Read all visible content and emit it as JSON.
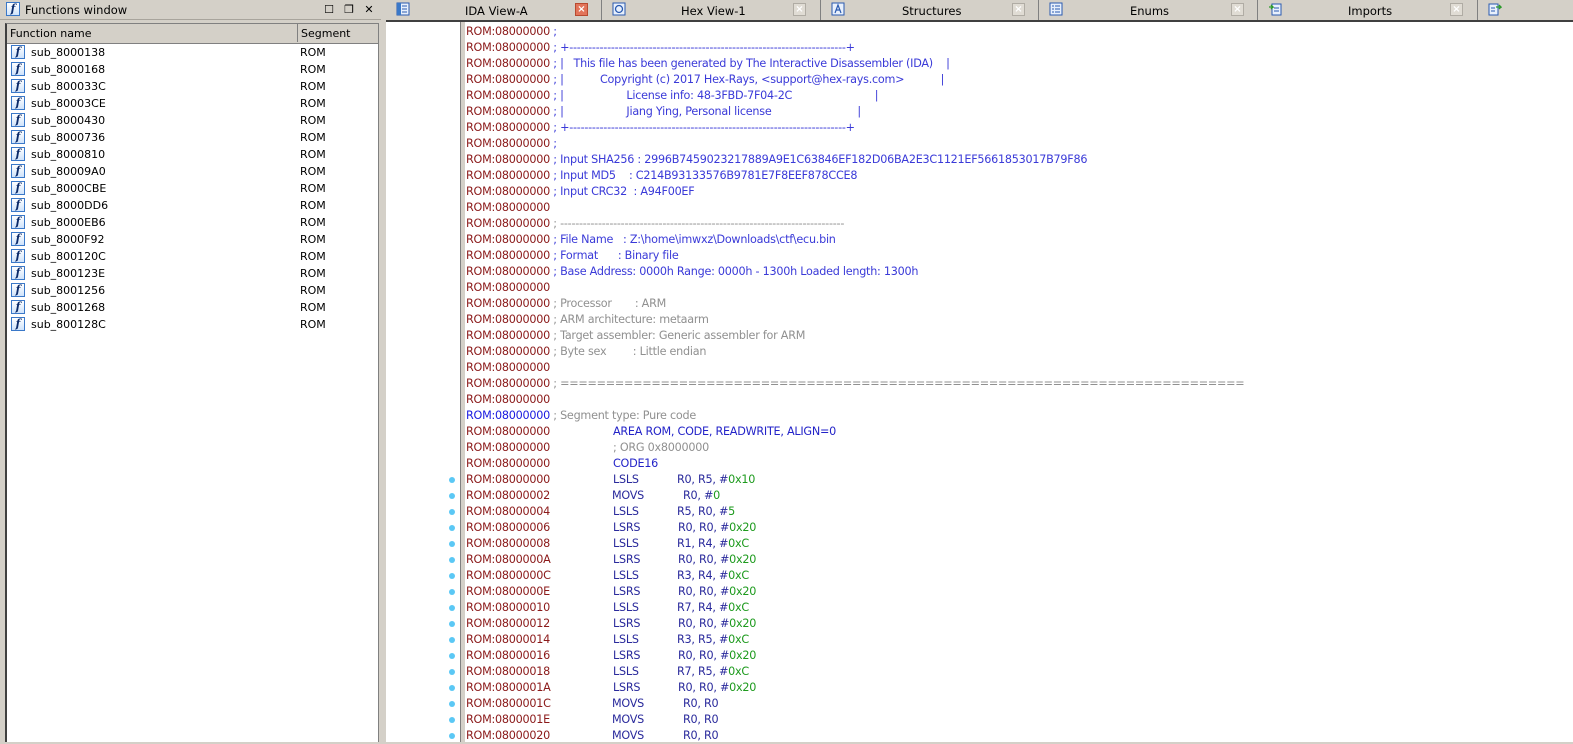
{
  "functions_window": {
    "title": "Functions window",
    "icon": "function-icon",
    "controls": [
      "maximize-icon",
      "float-icon",
      "close-icon"
    ],
    "columns": [
      "Function name",
      "Segment"
    ],
    "rows": [
      {
        "name": "sub_8000138",
        "segment": "ROM"
      },
      {
        "name": "sub_8000168",
        "segment": "ROM"
      },
      {
        "name": "sub_800033C",
        "segment": "ROM"
      },
      {
        "name": "sub_80003CE",
        "segment": "ROM"
      },
      {
        "name": "sub_8000430",
        "segment": "ROM"
      },
      {
        "name": "sub_8000736",
        "segment": "ROM"
      },
      {
        "name": "sub_8000810",
        "segment": "ROM"
      },
      {
        "name": "sub_80009A0",
        "segment": "ROM"
      },
      {
        "name": "sub_8000CBE",
        "segment": "ROM"
      },
      {
        "name": "sub_8000DD6",
        "segment": "ROM"
      },
      {
        "name": "sub_8000EB6",
        "segment": "ROM"
      },
      {
        "name": "sub_8000F92",
        "segment": "ROM"
      },
      {
        "name": "sub_800120C",
        "segment": "ROM"
      },
      {
        "name": "sub_800123E",
        "segment": "ROM"
      },
      {
        "name": "sub_8001256",
        "segment": "ROM"
      },
      {
        "name": "sub_8001268",
        "segment": "ROM"
      },
      {
        "name": "sub_800128C",
        "segment": "ROM"
      }
    ]
  },
  "tabs": [
    {
      "label": "IDA View-A",
      "icon": "ida-view-icon",
      "active": true
    },
    {
      "label": "Hex View-1",
      "icon": "hex-view-icon",
      "active": false
    },
    {
      "label": "Structures",
      "icon": "structures-icon",
      "active": false
    },
    {
      "label": "Enums",
      "icon": "enums-icon",
      "active": false
    },
    {
      "label": "Imports",
      "icon": "imports-icon",
      "active": false
    },
    {
      "label": "",
      "icon": "exports-icon",
      "active": false
    }
  ],
  "colors": {
    "address": "#8b1a1a",
    "segment_address": "#1a1ae0",
    "comment_blue": "#3a3ad8",
    "comment_gray": "#909090",
    "mnemonic": "#2a2a9c",
    "immediate": "#1d9a1d",
    "breakpoint_dot": "#5bc8f5",
    "close_active": "#e2745a"
  },
  "listing": {
    "header": [
      {
        "addr": "ROM:08000000",
        "text": " ;",
        "style": "blue"
      },
      {
        "addr": "ROM:08000000",
        "text": " ; +-------------------------------------------------------------------------+",
        "style": "blue"
      },
      {
        "addr": "ROM:08000000",
        "text": " ; |   This file has been generated by The Interactive Disassembler (IDA)    |",
        "style": "blue"
      },
      {
        "addr": "ROM:08000000",
        "text": " ; |           Copyright (c) 2017 Hex-Rays, <support@hex-rays.com>           |",
        "style": "blue"
      },
      {
        "addr": "ROM:08000000",
        "text": " ; |                   License info: 48-3FBD-7F04-2C                         |",
        "style": "blue"
      },
      {
        "addr": "ROM:08000000",
        "text": " ; |                   Jiang Ying, Personal license                          |",
        "style": "blue"
      },
      {
        "addr": "ROM:08000000",
        "text": " ; +-------------------------------------------------------------------------+",
        "style": "blue"
      },
      {
        "addr": "ROM:08000000",
        "text": " ;",
        "style": "blue"
      },
      {
        "addr": "ROM:08000000",
        "text": " ; Input SHA256 : 2996B7459023217889A9E1C63846EF182D06BA2E3C1121EF5661853017B79F86",
        "style": "blue"
      },
      {
        "addr": "ROM:08000000",
        "text": " ; Input MD5    : C214B93133576B9781E7F8EEF878CCE8",
        "style": "blue"
      },
      {
        "addr": "ROM:08000000",
        "text": " ; Input CRC32  : A94F00EF",
        "style": "blue"
      },
      {
        "addr": "ROM:08000000",
        "text": "",
        "style": "blue"
      },
      {
        "addr": "ROM:08000000",
        "text": " ; ---------------------------------------------------------------------------",
        "style": "gray"
      },
      {
        "addr": "ROM:08000000",
        "text": " ; File Name   : Z:\\home\\imwxz\\Downloads\\ctf\\ecu.bin",
        "style": "blue"
      },
      {
        "addr": "ROM:08000000",
        "text": " ; Format      : Binary file",
        "style": "blue"
      },
      {
        "addr": "ROM:08000000",
        "text": " ; Base Address: 0000h Range: 0000h - 1300h Loaded length: 1300h",
        "style": "blue"
      },
      {
        "addr": "ROM:08000000",
        "text": "",
        "style": "blue"
      },
      {
        "addr": "ROM:08000000",
        "text": " ; Processor       : ARM",
        "style": "gray"
      },
      {
        "addr": "ROM:08000000",
        "text": " ; ARM architecture: metaarm",
        "style": "gray"
      },
      {
        "addr": "ROM:08000000",
        "text": " ; Target assembler: Generic assembler for ARM",
        "style": "gray"
      },
      {
        "addr": "ROM:08000000",
        "text": " ; Byte sex        : Little endian",
        "style": "gray"
      },
      {
        "addr": "ROM:08000000",
        "text": "",
        "style": "gray"
      },
      {
        "addr": "ROM:08000000",
        "text": " ; ===========================================================================",
        "style": "gray"
      },
      {
        "addr": "ROM:08000000",
        "text": "",
        "style": "gray"
      },
      {
        "addr": "ROM:08000000",
        "text": " ; Segment type: Pure code",
        "style": "gray",
        "segment_addr": true
      }
    ],
    "directives": [
      {
        "addr": "ROM:08000000",
        "text": "AREA ROM, CODE, READWRITE, ALIGN=0",
        "style": "dir"
      },
      {
        "addr": "ROM:08000000",
        "text": "; ORG 0x8000000",
        "style": "gray"
      },
      {
        "addr": "ROM:08000000",
        "text": "CODE16",
        "style": "dir"
      }
    ],
    "instructions": [
      {
        "addr": "ROM:08000000",
        "mnemonic": "LSLS",
        "regs": "R0, R5, #",
        "imm": "0x10"
      },
      {
        "addr": "ROM:08000002",
        "mnemonic": "MOVS",
        "regs": "R0, #",
        "imm": "0"
      },
      {
        "addr": "ROM:08000004",
        "mnemonic": "LSLS",
        "regs": "R5, R0, #",
        "imm": "5"
      },
      {
        "addr": "ROM:08000006",
        "mnemonic": "LSRS",
        "regs": "R0, R0, #",
        "imm": "0x20"
      },
      {
        "addr": "ROM:08000008",
        "mnemonic": "LSLS",
        "regs": "R1, R4, #",
        "imm": "0xC"
      },
      {
        "addr": "ROM:0800000A",
        "mnemonic": "LSRS",
        "regs": "R0, R0, #",
        "imm": "0x20"
      },
      {
        "addr": "ROM:0800000C",
        "mnemonic": "LSLS",
        "regs": "R3, R4, #",
        "imm": "0xC"
      },
      {
        "addr": "ROM:0800000E",
        "mnemonic": "LSRS",
        "regs": "R0, R0, #",
        "imm": "0x20"
      },
      {
        "addr": "ROM:08000010",
        "mnemonic": "LSLS",
        "regs": "R7, R4, #",
        "imm": "0xC"
      },
      {
        "addr": "ROM:08000012",
        "mnemonic": "LSRS",
        "regs": "R0, R0, #",
        "imm": "0x20"
      },
      {
        "addr": "ROM:08000014",
        "mnemonic": "LSLS",
        "regs": "R3, R5, #",
        "imm": "0xC"
      },
      {
        "addr": "ROM:08000016",
        "mnemonic": "LSRS",
        "regs": "R0, R0, #",
        "imm": "0x20"
      },
      {
        "addr": "ROM:08000018",
        "mnemonic": "LSLS",
        "regs": "R7, R5, #",
        "imm": "0xC"
      },
      {
        "addr": "ROM:0800001A",
        "mnemonic": "LSRS",
        "regs": "R0, R0, #",
        "imm": "0x20"
      },
      {
        "addr": "ROM:0800001C",
        "mnemonic": "MOVS",
        "regs": "R0, R0",
        "imm": ""
      },
      {
        "addr": "ROM:0800001E",
        "mnemonic": "MOVS",
        "regs": "R0, R0",
        "imm": ""
      },
      {
        "addr": "ROM:08000020",
        "mnemonic": "MOVS",
        "regs": "R0, R0",
        "imm": ""
      }
    ]
  }
}
